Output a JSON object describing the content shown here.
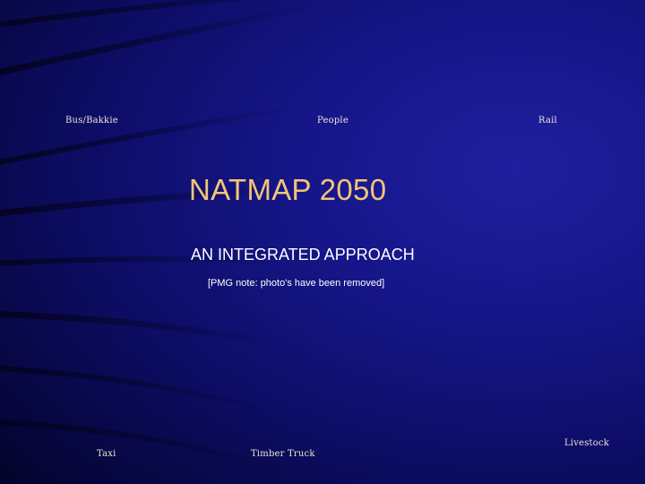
{
  "slide": {
    "title": "NATMAP 2050",
    "subtitle": "AN INTEGRATED APPROACH",
    "note": "[PMG note: photo's have been removed]",
    "photo_labels": {
      "bus": "Bus/Bakkie",
      "people": "People",
      "rail": "Rail",
      "taxi": "Taxi",
      "timber_truck": "Timber Truck",
      "livestock": "Livestock"
    }
  },
  "colors": {
    "background": "#16168a",
    "title": "#f3c47a",
    "text": "#ffffff",
    "label": "#ece6d2"
  }
}
